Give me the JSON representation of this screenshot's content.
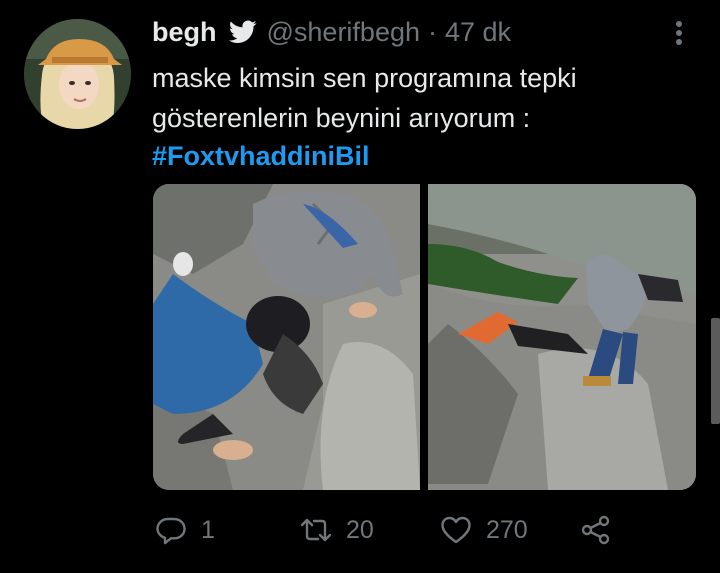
{
  "tweet": {
    "display_name": "begh",
    "handle": "@sherifbegh",
    "separator": "·",
    "time": "47 dk",
    "text": "maske kimsin sen programına tepki gösterenlerin beynini arıyorum :",
    "hashtag": "#FoxtvhaddiniBil"
  },
  "actions": {
    "reply_count": "1",
    "retweet_count": "20",
    "like_count": "270"
  },
  "colors": {
    "background": "#000000",
    "text": "#e7e9ea",
    "muted": "#71767b",
    "accent": "#1d9bf0"
  },
  "icons": [
    "twitter-bird-icon",
    "more-options-icon",
    "reply-icon",
    "retweet-icon",
    "like-icon",
    "share-icon"
  ]
}
